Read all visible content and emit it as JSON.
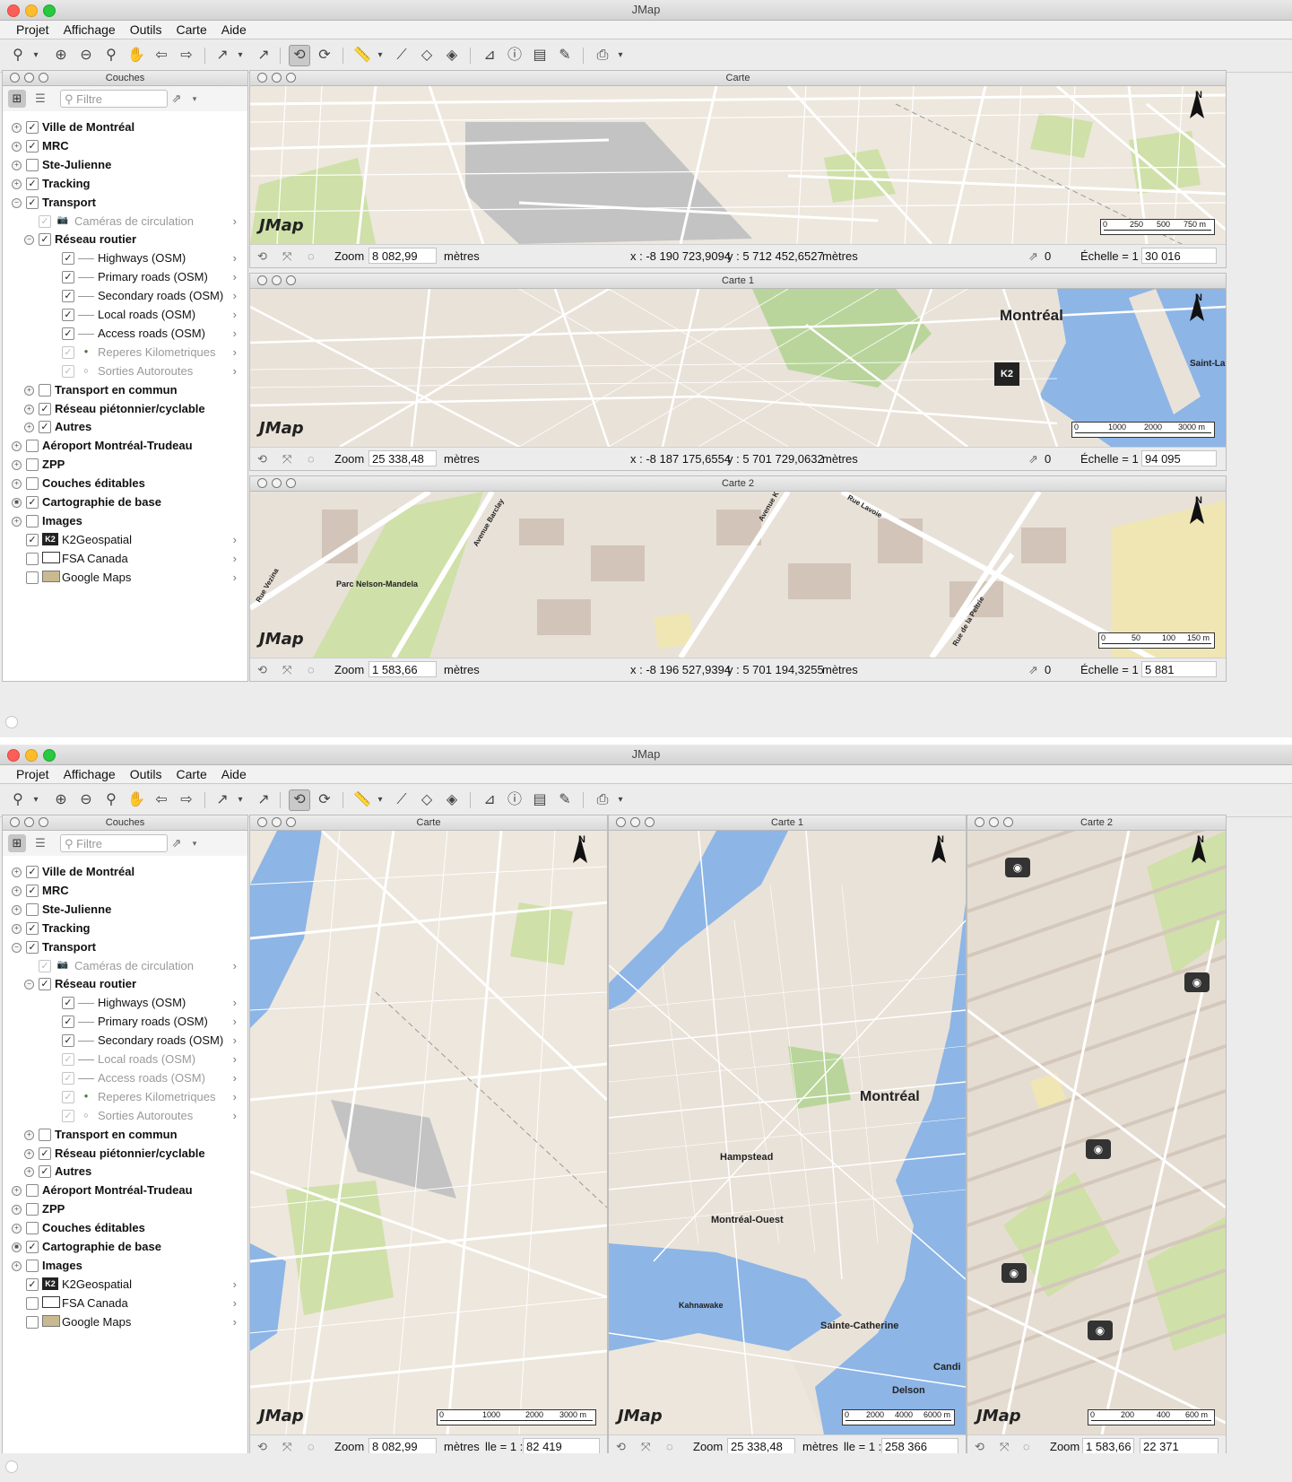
{
  "app": {
    "title": "JMap"
  },
  "menu": [
    "Projet",
    "Affichage",
    "Outils",
    "Carte",
    "Aide"
  ],
  "layers_panel": {
    "title": "Couches",
    "filter_placeholder": "Filtre",
    "items": [
      {
        "label": "Ville de Montréal",
        "checked": true,
        "bold": true
      },
      {
        "label": "MRC",
        "checked": true,
        "bold": true
      },
      {
        "label": "Ste-Julienne",
        "checked": false,
        "bold": true
      },
      {
        "label": "Tracking",
        "checked": true,
        "bold": true
      },
      {
        "label": "Transport",
        "checked": true,
        "bold": true
      },
      {
        "label": "Caméras de circulation",
        "checked": true,
        "dim": true
      },
      {
        "label": "Réseau routier",
        "checked": true,
        "bold": true
      },
      {
        "label": "Highways (OSM)",
        "checked": true
      },
      {
        "label": "Primary roads (OSM)",
        "checked": true
      },
      {
        "label": "Secondary roads (OSM)",
        "checked": true
      },
      {
        "label": "Local roads (OSM)",
        "checked": true
      },
      {
        "label": "Access roads (OSM)",
        "checked": true
      },
      {
        "label": "Reperes Kilometriques",
        "checked": true,
        "dim": true
      },
      {
        "label": "Sorties Autoroutes",
        "checked": true,
        "dim": true
      },
      {
        "label": "Transport en commun",
        "checked": false,
        "bold": true
      },
      {
        "label": "Réseau piétonnier/cyclable",
        "checked": true,
        "bold": true
      },
      {
        "label": "Autres",
        "checked": true,
        "bold": true
      },
      {
        "label": "Aéroport Montréal-Trudeau",
        "checked": false,
        "bold": true
      },
      {
        "label": "ZPP",
        "checked": false,
        "bold": true
      },
      {
        "label": "Couches éditables",
        "checked": false,
        "bold": true
      },
      {
        "label": "Cartographie de base",
        "checked": true,
        "bold": true
      },
      {
        "label": "Images",
        "checked": false,
        "bold": true
      },
      {
        "label": "K2Geospatial",
        "checked": true
      },
      {
        "label": "FSA Canada",
        "checked": false
      },
      {
        "label": "Google Maps",
        "checked": false
      }
    ]
  },
  "window1": {
    "maps": [
      {
        "title": "Carte",
        "zoom_label": "Zoom",
        "zoom": "8 082,99",
        "unit": "mètres",
        "x": "x : -8 190 723,9094",
        "y": "y : 5 712 452,6527",
        "coord_unit": "mètres",
        "count": "0",
        "scale_label": "Échelle = 1 :",
        "scale": "30 016",
        "scalebar": [
          "0",
          "250",
          "500",
          "750 m"
        ],
        "labels": []
      },
      {
        "title": "Carte 1",
        "zoom_label": "Zoom",
        "zoom": "25 338,48",
        "unit": "mètres",
        "x": "x : -8 187 175,6554",
        "y": "y : 5 701 729,0632",
        "coord_unit": "mètres",
        "count": "0",
        "scale_label": "Échelle = 1 :",
        "scale": "94 095",
        "scalebar": [
          "0",
          "1000",
          "2000",
          "3000 m"
        ],
        "labels": [
          "Montréal",
          "Saint-La"
        ]
      },
      {
        "title": "Carte 2",
        "zoom_label": "Zoom",
        "zoom": "1 583,66",
        "unit": "mètres",
        "x": "x : -8 196 527,9394",
        "y": "y : 5 701 194,3255",
        "coord_unit": "mètres",
        "count": "0",
        "scale_label": "Échelle = 1 :",
        "scale": "5 881",
        "scalebar": [
          "0",
          "50",
          "100",
          "150 m"
        ],
        "labels": [
          "Parc Nelson-Mandela",
          "Avenue Barclay",
          "Avenue K",
          "Rue Lavoie",
          "Rue Vezina",
          "Rue de la Peltrie"
        ]
      }
    ]
  },
  "window2": {
    "maps": [
      {
        "title": "Carte",
        "zoom_label": "Zoom",
        "zoom": "8 082,99",
        "unit": "mètres",
        "scale_label": "lle = 1 :",
        "scale": "82 419",
        "scalebar": [
          "0",
          "1000",
          "2000",
          "3000 m"
        ],
        "labels": []
      },
      {
        "title": "Carte 1",
        "zoom_label": "Zoom",
        "zoom": "25 338,48",
        "unit": "mètres",
        "scale_label": "lle = 1 :",
        "scale": "258 366",
        "scalebar": [
          "0",
          "2000",
          "4000",
          "6000 m"
        ],
        "labels": [
          "Montréal",
          "Hampstead",
          "Montréal-Ouest",
          "Kahnawake",
          "Sainte-Catherine",
          "Candi",
          "Delson"
        ]
      },
      {
        "title": "Carte 2",
        "zoom_label": "Zoom",
        "zoom": "1 583,66",
        "scale": "22 371",
        "scalebar": [
          "0",
          "200",
          "400",
          "600 m"
        ],
        "labels": []
      }
    ]
  },
  "watermark": "JMap",
  "north_label": "N",
  "colors": {
    "water": "#8db5e6",
    "land": "#ede7dd",
    "park": "#cfe0a8",
    "roads": "#ffffff",
    "building": "#d8cfc6",
    "airport": "#bdbdbd"
  }
}
